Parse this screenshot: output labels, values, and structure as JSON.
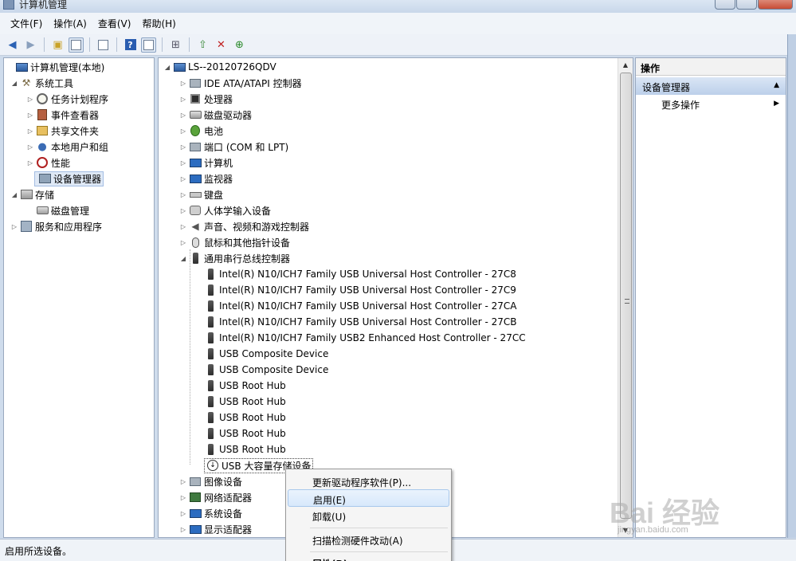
{
  "window": {
    "title": "计算机管理"
  },
  "menu": [
    "文件(F)",
    "操作(A)",
    "查看(V)",
    "帮助(H)"
  ],
  "toolbar": {
    "icons": [
      "back-icon",
      "forward-icon",
      "up-folder-icon",
      "show-hide-tree-icon",
      "properties-icon",
      "help-icon",
      "action-pane-icon",
      "scan-hardware-icon",
      "update-driver-icon",
      "uninstall-icon",
      "enable-device-icon"
    ]
  },
  "left_tree": {
    "root": "计算机管理(本地)",
    "system_tools": "系统工具",
    "task_scheduler": "任务计划程序",
    "event_viewer": "事件查看器",
    "shared_folders": "共享文件夹",
    "local_users": "本地用户和组",
    "performance": "性能",
    "device_manager": "设备管理器",
    "storage": "存储",
    "disk_management": "磁盘管理",
    "services": "服务和应用程序"
  },
  "device_tree": {
    "root": "LS--20120726QDV",
    "categories": [
      "IDE ATA/ATAPI 控制器",
      "处理器",
      "磁盘驱动器",
      "电池",
      "端口 (COM 和 LPT)",
      "计算机",
      "监视器",
      "键盘",
      "人体学输入设备",
      "声音、视频和游戏控制器",
      "鼠标和其他指针设备",
      "通用串行总线控制器"
    ],
    "usb_children": [
      "Intel(R) N10/ICH7 Family USB Universal Host Controller - 27C8",
      "Intel(R) N10/ICH7 Family USB Universal Host Controller - 27C9",
      "Intel(R) N10/ICH7 Family USB Universal Host Controller - 27CA",
      "Intel(R) N10/ICH7 Family USB Universal Host Controller - 27CB",
      "Intel(R) N10/ICH7 Family USB2 Enhanced Host Controller - 27CC",
      "USB Composite Device",
      "USB Composite Device",
      "USB Root Hub",
      "USB Root Hub",
      "USB Root Hub",
      "USB Root Hub",
      "USB Root Hub",
      "USB 大容量存储设备"
    ],
    "more_categories": [
      "图像设备",
      "网络适配器",
      "系统设备",
      "显示适配器"
    ]
  },
  "actions_pane": {
    "title": "操作",
    "section": "设备管理器",
    "more_actions": "更多操作"
  },
  "context_menu": {
    "update_driver": "更新驱动程序软件(P)...",
    "enable": "启用(E)",
    "uninstall": "卸载(U)",
    "scan": "扫描检测硬件改动(A)",
    "properties": "属性(R)"
  },
  "status_bar": "启用所选设备。",
  "watermark": {
    "brand": "Bai 经验",
    "url": "jingyan.baidu.com"
  }
}
